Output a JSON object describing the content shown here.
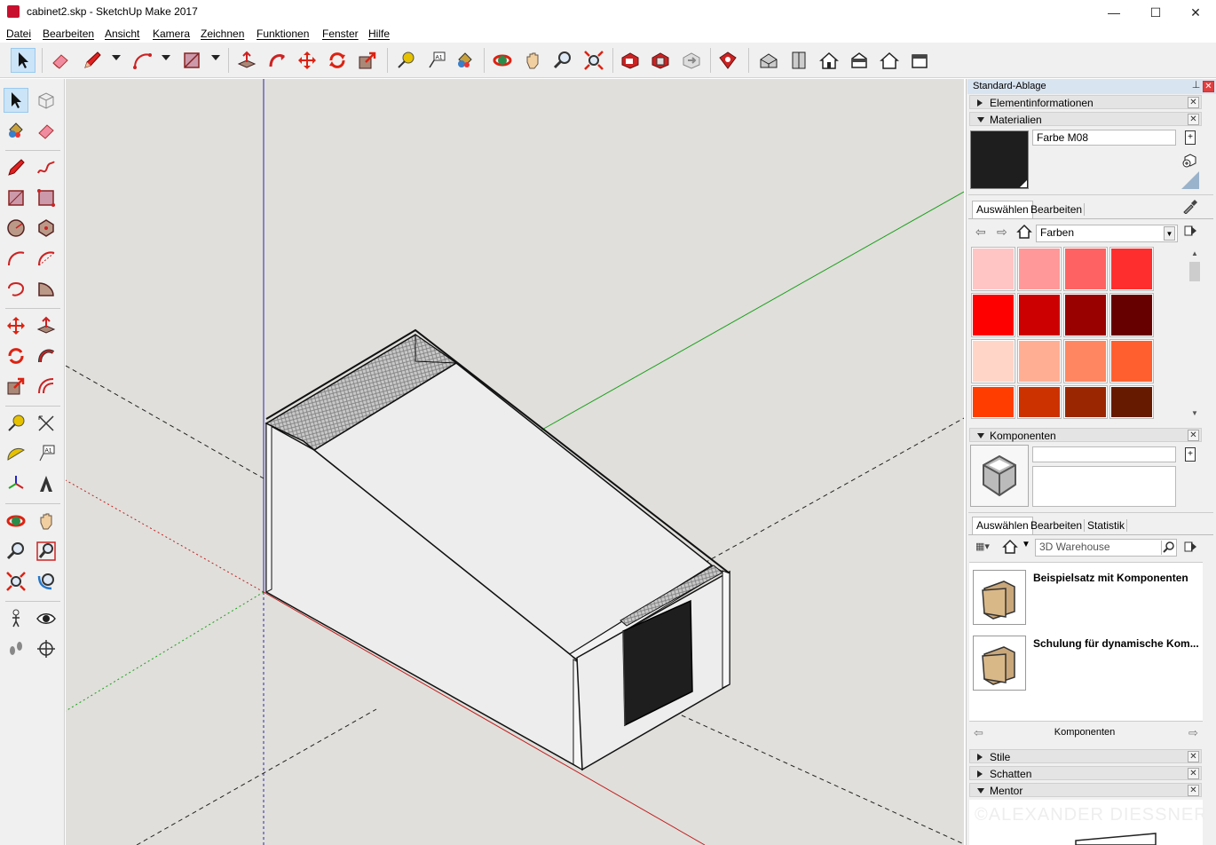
{
  "window": {
    "title": "cabinet2.skp - SketchUp Make 2017",
    "min": "—",
    "max": "☐",
    "close": "✕"
  },
  "menu": [
    "Datei",
    "Bearbeiten",
    "Ansicht",
    "Kamera",
    "Zeichnen",
    "Funktionen",
    "Fenster",
    "Hilfe"
  ],
  "tray": {
    "title": "Standard-Ablage",
    "panels": {
      "entity_info": "Elementinformationen",
      "materials": "Materialien",
      "components": "Komponenten",
      "styles": "Stile",
      "shadows": "Schatten",
      "mentor": "Mentor"
    },
    "materials": {
      "name_value": "Farbe M08",
      "current_color": "#1e1e1e",
      "tabs": [
        "Auswählen",
        "Bearbeiten"
      ],
      "library": "Farben",
      "swatches": [
        "#ffc5c5",
        "#ff9898",
        "#ff6262",
        "#ff2e2e",
        "#ff0000",
        "#cc0000",
        "#990000",
        "#660000",
        "#ffd5c8",
        "#ffae94",
        "#ff8660",
        "#ff5f2e",
        "#ff3d00",
        "#cc3100",
        "#992600",
        "#661a00"
      ]
    },
    "components": {
      "tabs": [
        "Auswählen",
        "Bearbeiten",
        "Statistik"
      ],
      "search_placeholder": "3D Warehouse",
      "items": [
        "Beispielsatz mit Komponenten",
        "Schulung für dynamische Kom..."
      ],
      "footer": "Komponenten"
    },
    "watermark": "©ALEXANDER DIESSNER"
  }
}
